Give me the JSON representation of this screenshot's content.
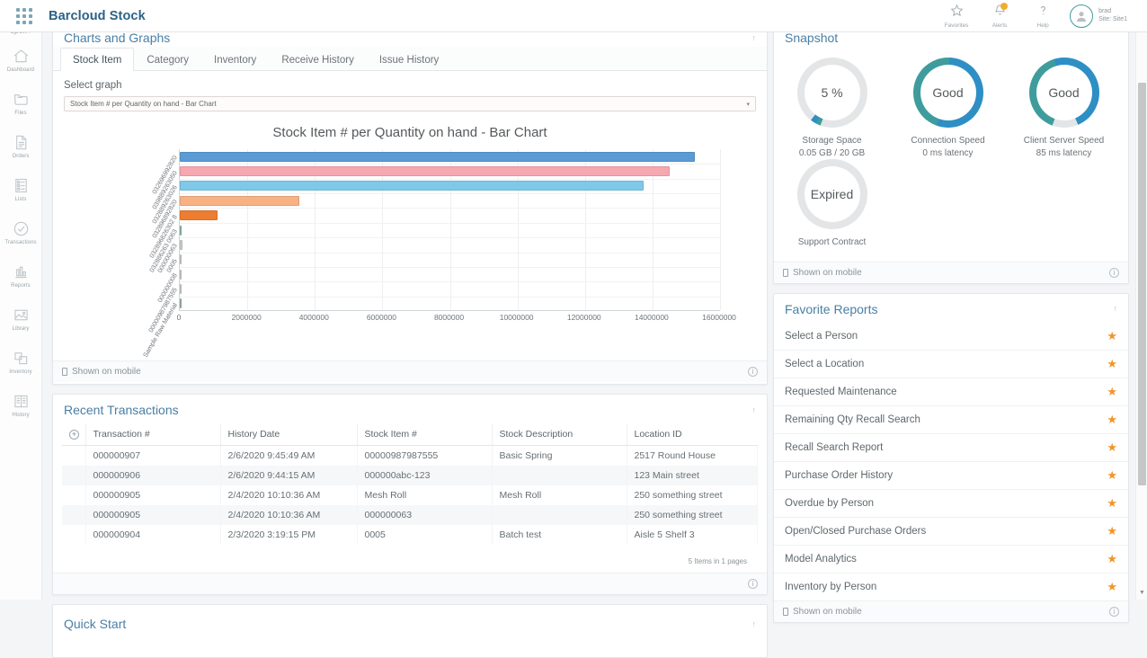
{
  "app": {
    "title": "Barcloud Stock",
    "waffle_icon": "apps-grid-icon"
  },
  "topbar": {
    "items": [
      {
        "label": "Favorites",
        "icon": "star-outline-icon"
      },
      {
        "label": "Alerts",
        "icon": "bell-icon"
      },
      {
        "label": "Help",
        "icon": "question-mark-icon"
      }
    ],
    "user": {
      "name": "brad",
      "site": "Site: Site1",
      "avatar_icon": "user-avatar-icon"
    }
  },
  "sidebar": {
    "toggle_label": "open",
    "toggle_icon": "chevron-right-icon",
    "items": [
      {
        "label": "Dashboard",
        "icon": "home-icon"
      },
      {
        "label": "Files",
        "icon": "folder-icon"
      },
      {
        "label": "Orders",
        "icon": "document-icon"
      },
      {
        "label": "Lists",
        "icon": "list-icon"
      },
      {
        "label": "Transactions",
        "icon": "check-circle-icon"
      },
      {
        "label": "Reports",
        "icon": "bar-chart-icon"
      },
      {
        "label": "Library",
        "icon": "image-icon"
      },
      {
        "label": "Inventory",
        "icon": "boxes-icon"
      },
      {
        "label": "History",
        "icon": "book-icon"
      }
    ]
  },
  "charts_panel": {
    "title": "Charts and Graphs",
    "caret": "↑",
    "tabs": [
      {
        "label": "Stock Item",
        "active": true
      },
      {
        "label": "Category",
        "active": false
      },
      {
        "label": "Inventory",
        "active": false
      },
      {
        "label": "Receive History",
        "active": false
      },
      {
        "label": "Issue History",
        "active": false
      }
    ],
    "select_label": "Select graph",
    "select_value": "Stock Item # per Quantity on hand - Bar Chart",
    "select_caret": "▾",
    "footer": {
      "mobile_label": "Shown on mobile",
      "info_label": "i"
    }
  },
  "chart_data": {
    "type": "bar",
    "orientation": "horizontal",
    "title": "Stock Item # per Quantity on hand - Bar Chart",
    "xlabel": "",
    "ylabel": "",
    "xlim": [
      0,
      16000000
    ],
    "xticks": [
      0,
      2000000,
      4000000,
      6000000,
      8000000,
      10000000,
      12000000,
      14000000,
      16000000
    ],
    "xtick_labels": [
      "0",
      "2000000",
      "4000000",
      "6000000",
      "8000000",
      "10000000",
      "12000000",
      "14000000",
      "16000000"
    ],
    "grid": true,
    "legend": false,
    "categories": [
      "032696992820",
      "039889263050",
      "032889263026",
      "032896892820",
      "032896826302 8",
      "032886263 0063",
      "000000063",
      "0005",
      "000000008",
      "00000987987555",
      "Sample Raw Material"
    ],
    "values": [
      15250000,
      14500000,
      13750000,
      3550000,
      1130000,
      0,
      70000,
      9000,
      2000,
      1000,
      9000
    ],
    "colors": [
      "#5b9bd5",
      "#f6a7b0",
      "#7ec8e8",
      "#f8b183",
      "#ed7d31",
      "#8fb5b0",
      "#c9cdd0",
      "#c9cdd0",
      "#c9cdd0",
      "#c9cdd0",
      "#9ab5ae"
    ]
  },
  "transactions_panel": {
    "title": "Recent Transactions",
    "caret": "↑",
    "add_icon": "plus-circle-icon",
    "columns": [
      "Transaction #",
      "History Date",
      "Stock Item #",
      "Stock Description",
      "Location ID"
    ],
    "rows": [
      [
        "000000907",
        "2/6/2020 9:45:49 AM",
        "00000987987555",
        "Basic Spring",
        "2517 Round House"
      ],
      [
        "000000906",
        "2/6/2020 9:44:15 AM",
        "000000abc-123",
        "",
        "123 Main street"
      ],
      [
        "000000905",
        "2/4/2020 10:10:36 AM",
        "Mesh Roll",
        "Mesh Roll",
        "250 something street"
      ],
      [
        "000000905",
        "2/4/2020 10:10:36 AM",
        "000000063",
        "",
        "250 something street"
      ],
      [
        "000000904",
        "2/3/2020 3:19:15 PM",
        "0005",
        "Batch test",
        "Aisle 5 Shelf 3"
      ]
    ],
    "pager_text": "5 Items in 1 pages",
    "footer": {
      "info_label": "i"
    }
  },
  "quick_start_panel": {
    "title": "Quick Start",
    "caret": "↑"
  },
  "snapshot_panel": {
    "title": "Snapshot",
    "gauges": [
      {
        "value": "5 %",
        "caption": "Storage Space",
        "sub": "0.05 GB / 20 GB",
        "percent": 5,
        "color": "#3f9c9c",
        "color2": "#2e8fc4",
        "track": "#e3e5e6"
      },
      {
        "value": "Good",
        "caption": "Connection Speed",
        "sub": "0 ms latency",
        "percent": 100,
        "color": "#3f9c9c",
        "color2": "#2e8fc4",
        "track": "#e3e5e6"
      },
      {
        "value": "Good",
        "caption": "Client Server Speed",
        "sub": "85 ms latency",
        "percent": 88,
        "color": "#3f9c9c",
        "color2": "#2e8fc4",
        "track": "#e3e5e6"
      },
      {
        "value": "Expired",
        "caption": "Support Contract",
        "sub": "",
        "percent": 0,
        "color": "#e3e5e6",
        "color2": "#e3e5e6",
        "track": "#e3e5e6"
      }
    ],
    "footer": {
      "mobile_label": "Shown on mobile",
      "info_label": "i"
    }
  },
  "favorite_reports_panel": {
    "title": "Favorite Reports",
    "caret": "↑",
    "star_icon": "star-filled-icon",
    "items": [
      "Select a Person",
      "Select a Location",
      "Requested Maintenance",
      "Remaining Qty Recall Search",
      "Recall Search Report",
      "Purchase Order History",
      "Overdue by Person",
      "Open/Closed Purchase Orders",
      "Model Analytics",
      "Inventory by Person"
    ],
    "footer": {
      "mobile_label": "Shown on mobile",
      "info_label": "i"
    }
  },
  "colors": {
    "brand": "#2b6287",
    "panel_title": "#4a7fa5",
    "star": "#f0952a",
    "teal": "#3f9c9c",
    "blue": "#2e8fc4"
  }
}
